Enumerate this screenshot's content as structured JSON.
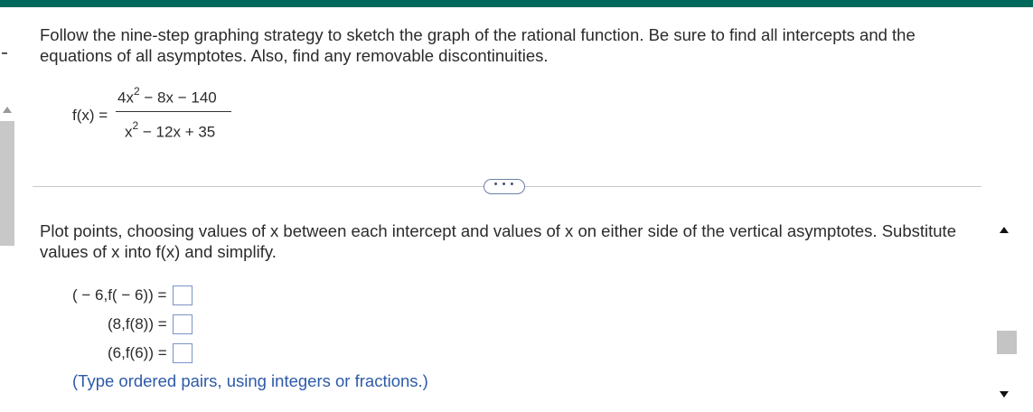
{
  "question": {
    "text": "Follow the nine-step graphing strategy to sketch the graph of the rational function. Be sure to find all intercepts and the equations of all asymptotes. Also, find any removable discontinuities."
  },
  "formula": {
    "lhs": "f(x) =",
    "numerator_lead": "4x",
    "numerator_exp": "2",
    "numerator_tail": " − 8x − 140",
    "denominator_lead": "x",
    "denominator_exp": "2",
    "denominator_tail": " − 12x + 35"
  },
  "more_button": {
    "label": "• • •"
  },
  "instruction": {
    "text": "Plot points, choosing values of x between each intercept and values of x on either side of the vertical asymptotes. Substitute values of x into f(x) and simplify."
  },
  "answers": [
    {
      "label": "( − 6,f( − 6)) =",
      "value": ""
    },
    {
      "label": "(8,f(8)) =",
      "value": ""
    },
    {
      "label": "(6,f(6)) =",
      "value": ""
    }
  ],
  "hint": {
    "text": "(Type ordered pairs, using integers or fractions.)"
  },
  "colors": {
    "topbar": "#00695c",
    "hint": "#2d5aa8",
    "input_border": "#7a94c4"
  }
}
